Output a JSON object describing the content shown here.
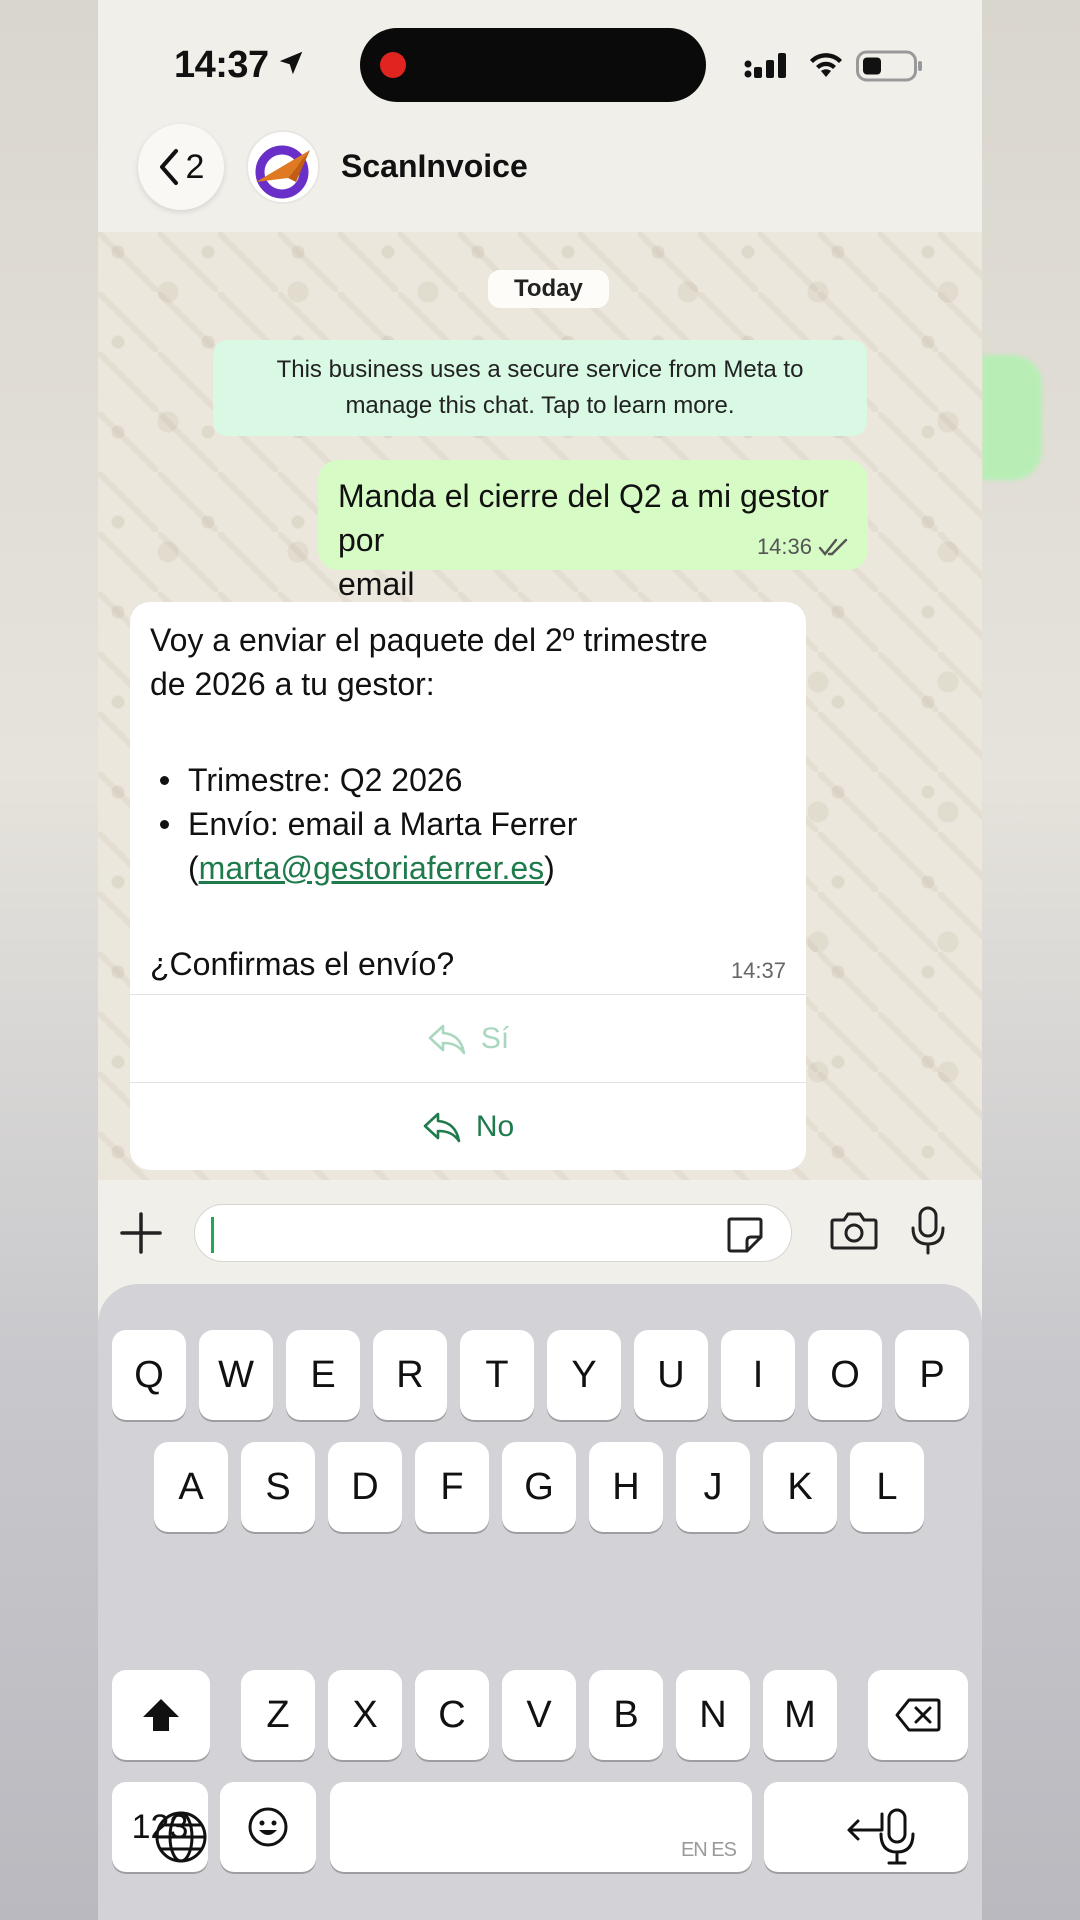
{
  "status_bar": {
    "time": "14:37"
  },
  "header": {
    "back_count": "2",
    "title": "ScanInvoice"
  },
  "chat": {
    "date_label": "Today",
    "meta_notice_line1": "This business uses a secure service from Meta to",
    "meta_notice_line2": "manage this chat. Tap to learn more.",
    "outgoing": {
      "line1": "Manda el cierre del Q2 a mi gestor por",
      "line2": "email",
      "time": "14:36"
    },
    "incoming": {
      "line1": "Voy a enviar el paquete del 2º trimestre",
      "line2": "de 2026 a tu gestor:",
      "bullet1": "Trimestre: Q2 2026",
      "bullet2": "Envío: email a Marta Ferrer",
      "bullet2_open": "(",
      "bullet2_email": "marta@gestoriaferrer.es",
      "bullet2_close": ")",
      "question": "¿Confirmas el envío?",
      "time": "14:37"
    },
    "quick_replies": {
      "yes": "Sí",
      "no": "No"
    }
  },
  "keyboard": {
    "row1": [
      "Q",
      "W",
      "E",
      "R",
      "T",
      "Y",
      "U",
      "I",
      "O",
      "P"
    ],
    "row2": [
      "A",
      "S",
      "D",
      "F",
      "G",
      "H",
      "J",
      "K",
      "L"
    ],
    "row3": [
      "Z",
      "X",
      "C",
      "V",
      "B",
      "N",
      "M"
    ],
    "numbers_key": "123",
    "space_hint": "EN ES"
  },
  "colors": {
    "accent": "#1f7a4c",
    "outgoing_bubble": "#d6fbc5",
    "notice_bubble": "#d9f9e4",
    "recording_dot": "#e0241f"
  },
  "icons": {
    "status": [
      "location-arrow-icon",
      "cellular-signal-icon",
      "wifi-icon",
      "battery-icon"
    ],
    "composer": [
      "plus-icon",
      "sticker-icon",
      "camera-icon",
      "microphone-icon"
    ],
    "keyboard": [
      "shift-icon",
      "backspace-icon",
      "emoji-icon",
      "return-icon",
      "globe-icon",
      "dictation-mic-icon"
    ]
  }
}
